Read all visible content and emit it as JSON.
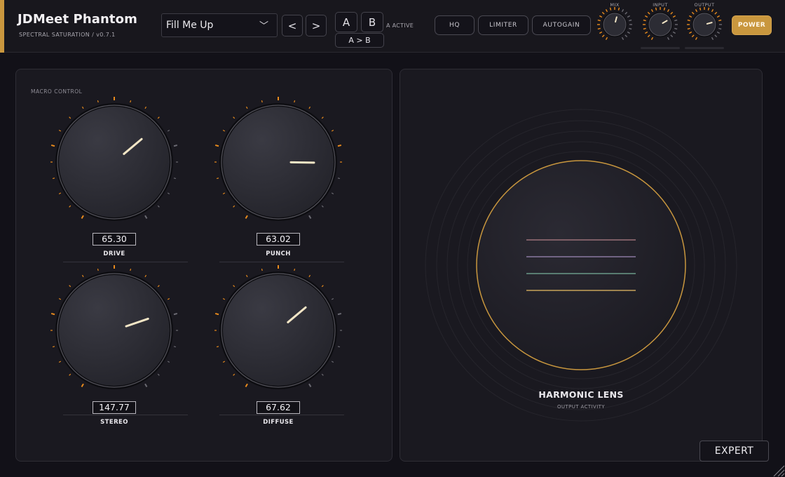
{
  "app": {
    "title": "JDMeet Phantom",
    "subtitle": "SPECTRAL SATURATION  /  v0.7.1"
  },
  "header": {
    "preset": {
      "value": "Fill Me Up",
      "chevron_icon": "chevron-down-icon"
    },
    "prev_label": "<",
    "next_label": ">",
    "ab": {
      "a_label": "A",
      "b_label": "B",
      "copy_label": "A > B",
      "active_text": "A ACTIVE"
    },
    "toggles": {
      "hq_label": "HQ",
      "limiter_label": "LIMITER",
      "autogain_label": "AUTOGAIN"
    },
    "mini_knobs": [
      {
        "id": "mix",
        "label": "MIX",
        "value_fraction": 0.55
      },
      {
        "id": "input",
        "label": "INPUT",
        "value_fraction": 0.7
      },
      {
        "id": "output",
        "label": "OUTPUT",
        "value_fraction": 0.75
      }
    ],
    "power_label": "POWER"
  },
  "macro": {
    "section_label": "MACRO CONTROL",
    "knobs": [
      {
        "id": "drive",
        "label": "DRIVE",
        "value": "65.30",
        "angle_deg": 50
      },
      {
        "id": "punch",
        "label": "PUNCH",
        "value": "63.02",
        "angle_deg": 91
      },
      {
        "id": "stereo",
        "label": "STEREO",
        "value": "147.77",
        "angle_deg": 71
      },
      {
        "id": "diffuse",
        "label": "DIFFUSE",
        "value": "67.62",
        "angle_deg": 50
      }
    ]
  },
  "lens": {
    "title": "HARMONIC LENS",
    "subtitle": "OUTPUT ACTIVITY",
    "line_colors": [
      "#9a7078",
      "#8a78a0",
      "#6a9a88",
      "#c8a35a"
    ]
  },
  "expert_label": "EXPERT",
  "colors": {
    "accent": "#c9973e",
    "tick_active": "#e88a1c",
    "tick_inactive": "#6b6a72",
    "pointer": "#f3e6c6"
  }
}
